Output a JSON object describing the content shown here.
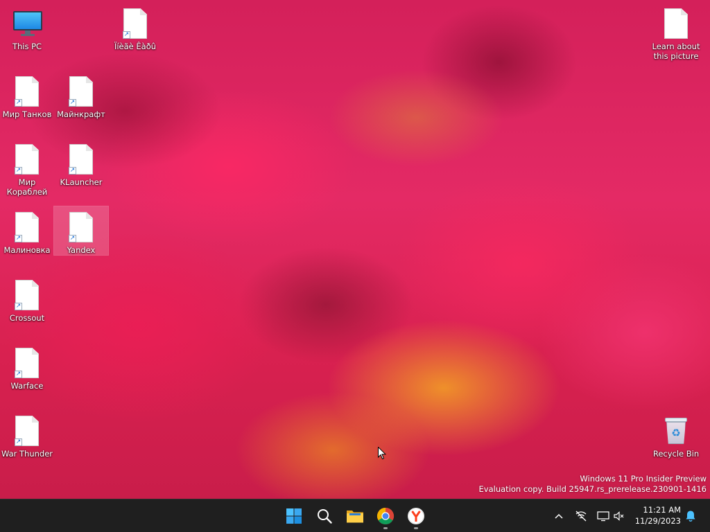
{
  "desktop": {
    "icons": [
      {
        "label": "This PC",
        "type": "this-pc"
      },
      {
        "label": "Ïíèãè Êàðû",
        "type": "document-shortcut"
      },
      {
        "label": "Learn about this picture",
        "type": "document"
      },
      {
        "label": "Мир Танков",
        "type": "document-shortcut"
      },
      {
        "label": "Майнкрафт",
        "type": "document-shortcut"
      },
      {
        "label": "Мир Кораблей",
        "type": "document-shortcut"
      },
      {
        "label": "KLauncher",
        "type": "document-shortcut"
      },
      {
        "label": "Малиновка",
        "type": "document-shortcut"
      },
      {
        "label": "Yandex",
        "type": "document-shortcut",
        "selected": true
      },
      {
        "label": "Crossout",
        "type": "document-shortcut"
      },
      {
        "label": "Warface",
        "type": "document-shortcut"
      },
      {
        "label": "War Thunder",
        "type": "document-shortcut"
      },
      {
        "label": "Recycle Bin",
        "type": "recycle-bin"
      }
    ],
    "watermark": {
      "line1": "Windows 11 Pro Insider Preview",
      "line2": "Evaluation copy. Build 25947.rs_prerelease.230901-1416"
    }
  },
  "taskbar": {
    "apps": [
      {
        "name": "Start",
        "icon": "windows-start-icon"
      },
      {
        "name": "Search",
        "icon": "search-icon"
      },
      {
        "name": "File Explorer",
        "icon": "folder-icon"
      },
      {
        "name": "Google Chrome",
        "icon": "chrome-icon",
        "running": true
      },
      {
        "name": "Yandex Browser",
        "icon": "yandex-browser-icon",
        "running": true
      }
    ],
    "tray": {
      "icons": [
        "chevron-up-icon",
        "no-network-icon",
        "display-icon",
        "volume-muted-icon",
        "notification-bell-icon"
      ],
      "time": "11:21 AM",
      "date": "11/29/2023"
    }
  },
  "colors": {
    "taskbar_bg": "#1f1f1f",
    "accent_blue": "#1e88e5"
  }
}
